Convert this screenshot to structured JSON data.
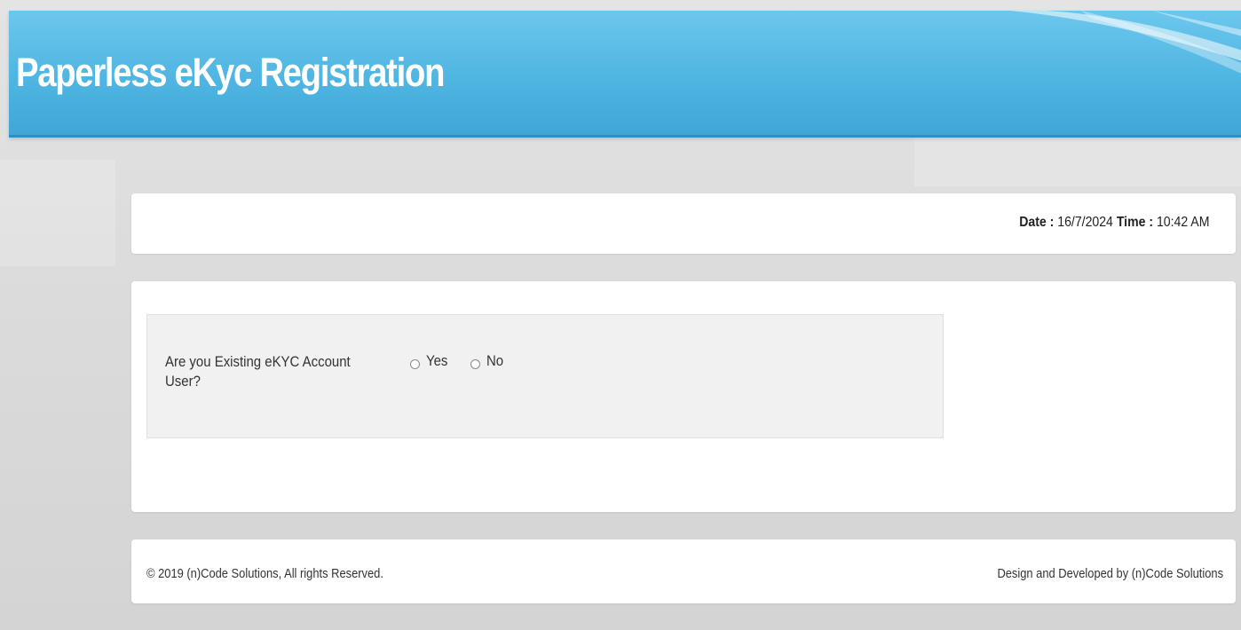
{
  "header": {
    "title": "Paperless eKyc Registration",
    "background_color": "#4fb5e2"
  },
  "datetime": {
    "date_label": "Date :",
    "date_value": "16/7/2024",
    "time_label": "Time :",
    "time_value": "10:42 AM"
  },
  "form": {
    "question": "Are you Existing eKYC Account User?",
    "options": [
      {
        "label": "Yes",
        "selected": false
      },
      {
        "label": "No",
        "selected": false
      }
    ]
  },
  "footer": {
    "copyright": "© 2019 (n)Code Solutions, All rights Reserved.",
    "credits": "Design and Developed by (n)Code Solutions"
  }
}
